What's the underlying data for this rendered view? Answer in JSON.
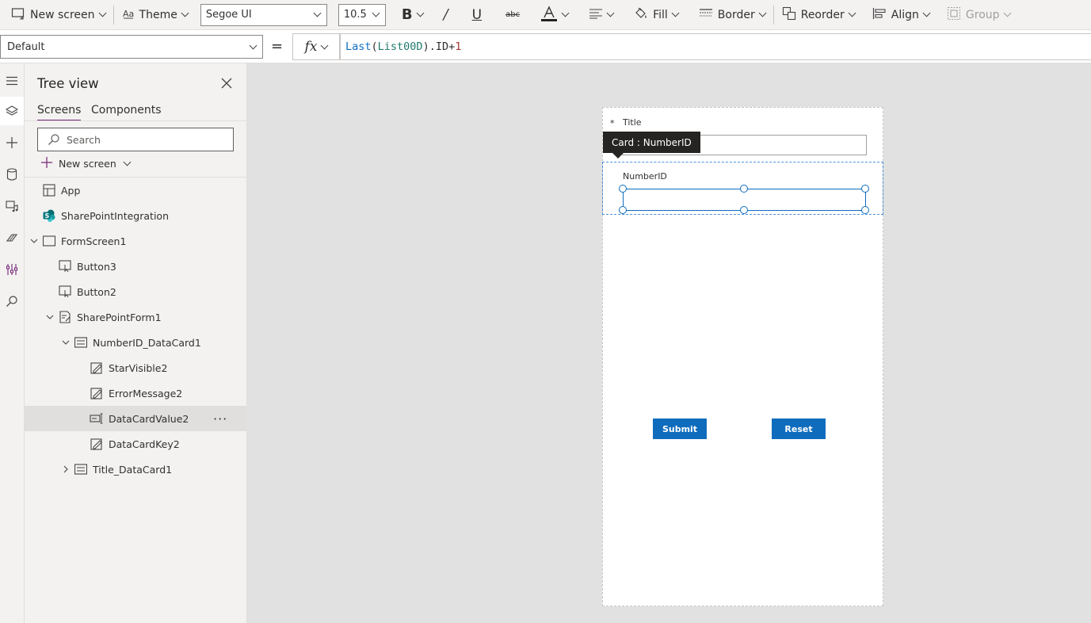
{
  "toolbar": {
    "new_screen": "New screen",
    "theme": "Theme",
    "font_family": "Segoe UI",
    "font_size": "10.5",
    "fill": "Fill",
    "border": "Border",
    "reorder": "Reorder",
    "align": "Align",
    "group": "Group"
  },
  "formula_bar": {
    "property": "Default",
    "equals": "=",
    "fx": "fx",
    "formula": {
      "fn": "Last",
      "open": "(",
      "ref": "List00D",
      "close": ").ID+",
      "num": "1"
    }
  },
  "tree_view": {
    "title": "Tree view",
    "tabs": {
      "screens": "Screens",
      "components": "Components"
    },
    "search_placeholder": "Search",
    "new_screen": "New screen",
    "nodes": [
      "App",
      "SharePointIntegration",
      "FormScreen1",
      "Button3",
      "Button2",
      "SharePointForm1",
      "NumberID_DataCard1",
      "StarVisible2",
      "ErrorMessage2",
      "DataCardValue2",
      "DataCardKey2",
      "Title_DataCard1"
    ],
    "more": "···"
  },
  "canvas": {
    "required_star": "*",
    "title_label": "Title",
    "tooltip": "Card : NumberID",
    "number_label": "NumberID",
    "submit": "Submit",
    "reset": "Reset"
  },
  "colors": {
    "accent": "#742774",
    "primary_button": "#0f6cbd",
    "selection": "#0f6cbd"
  }
}
